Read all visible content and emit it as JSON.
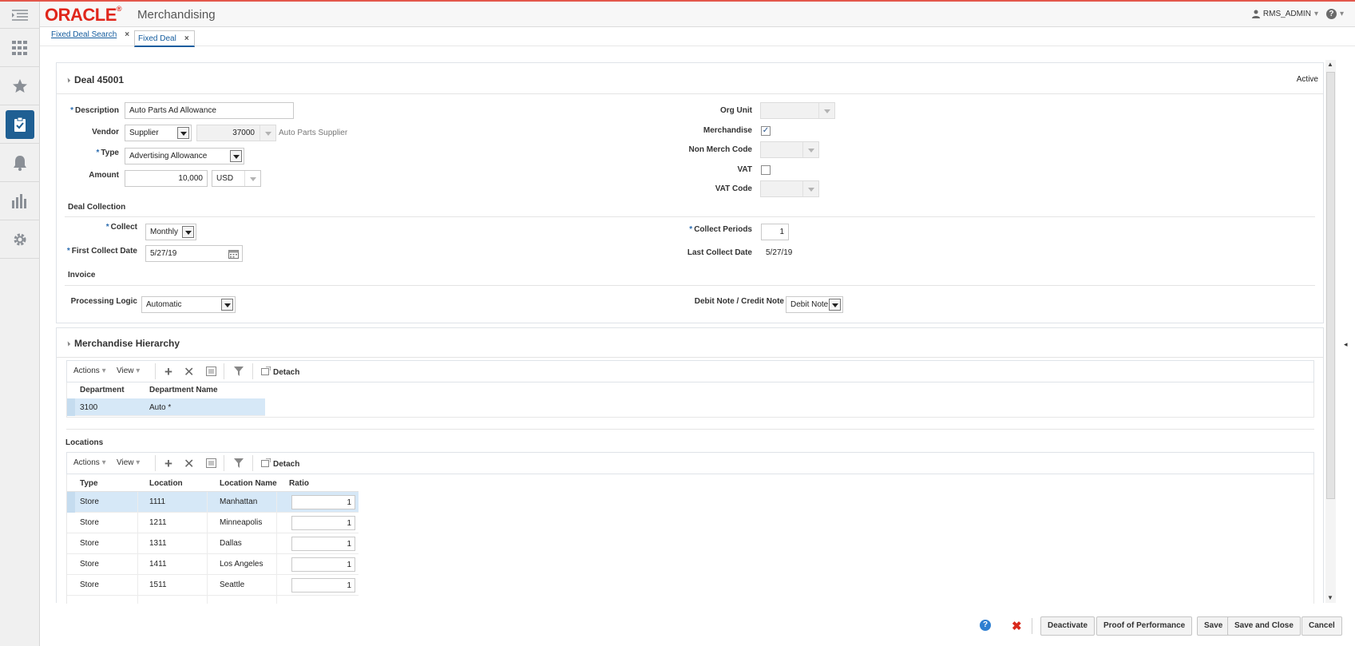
{
  "header": {
    "logo": "ORACLE",
    "app_name": "Merchandising",
    "user": "RMS_ADMIN"
  },
  "tabs": [
    {
      "label": "Fixed Deal Search",
      "close": "×"
    },
    {
      "label": "Fixed Deal",
      "close": "×"
    }
  ],
  "deal": {
    "title": "Deal 45001",
    "status": "Active",
    "description": {
      "label": "Description",
      "value": "Auto Parts Ad Allowance"
    },
    "vendor": {
      "label": "Vendor",
      "type_value": "Supplier",
      "id_value": "37000",
      "name": "Auto Parts Supplier"
    },
    "type": {
      "label": "Type",
      "value": "Advertising Allowance"
    },
    "amount": {
      "label": "Amount",
      "value": "10,000",
      "currency": "USD"
    },
    "org_unit": {
      "label": "Org Unit",
      "value": ""
    },
    "merchandise": {
      "label": "Merchandise",
      "checked": true
    },
    "non_merch_code": {
      "label": "Non Merch Code",
      "value": ""
    },
    "vat": {
      "label": "VAT",
      "checked": false
    },
    "vat_code": {
      "label": "VAT Code",
      "value": ""
    }
  },
  "collection": {
    "title": "Deal Collection",
    "collect": {
      "label": "Collect",
      "value": "Monthly"
    },
    "first_collect_date": {
      "label": "First Collect Date",
      "value": "5/27/19"
    },
    "collect_periods": {
      "label": "Collect Periods",
      "value": "1"
    },
    "last_collect_date": {
      "label": "Last Collect Date",
      "value": "5/27/19"
    }
  },
  "invoice": {
    "title": "Invoice",
    "processing_logic": {
      "label": "Processing Logic",
      "value": "Automatic"
    },
    "debit_credit": {
      "label": "Debit Note / Credit Note",
      "value": "Debit Note"
    }
  },
  "hierarchy": {
    "title": "Merchandise Hierarchy",
    "toolbar": {
      "actions": "Actions",
      "view": "View",
      "detach": "Detach"
    },
    "columns": [
      "Department",
      "Department Name"
    ],
    "rows": [
      {
        "department": "3100",
        "name": "Auto *"
      }
    ]
  },
  "locations": {
    "title": "Locations",
    "toolbar": {
      "actions": "Actions",
      "view": "View",
      "detach": "Detach"
    },
    "columns": [
      "Type",
      "Location",
      "Location Name",
      "Ratio"
    ],
    "rows": [
      {
        "type": "Store",
        "location": "1111",
        "name": "Manhattan",
        "ratio": "1"
      },
      {
        "type": "Store",
        "location": "1211",
        "name": "Minneapolis",
        "ratio": "1"
      },
      {
        "type": "Store",
        "location": "1311",
        "name": "Dallas",
        "ratio": "1"
      },
      {
        "type": "Store",
        "location": "1411",
        "name": "Los Angeles",
        "ratio": "1"
      },
      {
        "type": "Store",
        "location": "1511",
        "name": "Seattle",
        "ratio": "1"
      }
    ]
  },
  "footer": {
    "deactivate": "Deactivate",
    "proof": "Proof of Performance",
    "save": "Save",
    "save_close": "Save and Close",
    "cancel": "Cancel"
  },
  "icons": {
    "rail": [
      "menu-icon",
      "apps-grid-icon",
      "star-icon",
      "tasks-icon",
      "bell-icon",
      "reports-icon",
      "settings-icon"
    ],
    "accent": "#1f5f93",
    "brand": "#e0261b"
  }
}
